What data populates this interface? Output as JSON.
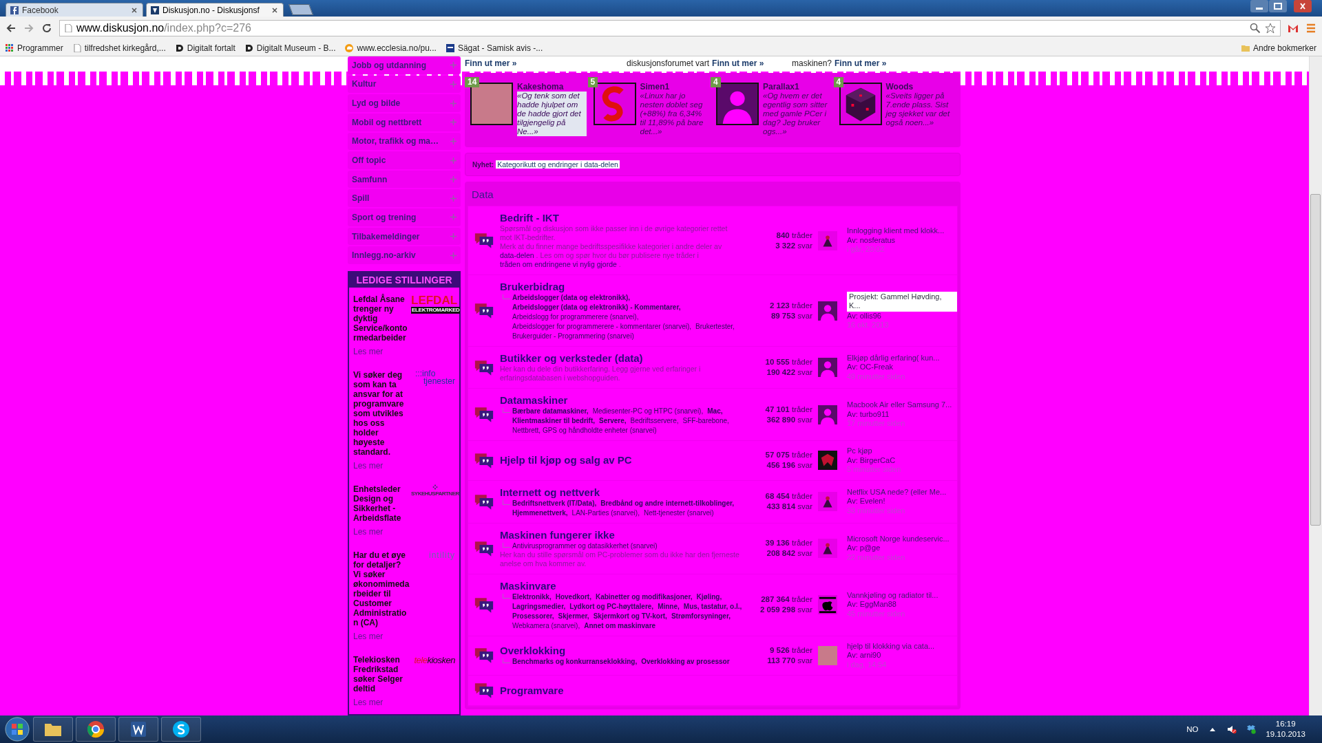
{
  "browser": {
    "tabs": [
      {
        "title": "Facebook",
        "selected": false
      },
      {
        "title": "Diskusjon.no - Diskusjonsf",
        "selected": true
      }
    ],
    "url_domain": "www.diskusjon.no",
    "url_path": "/index.php?c=276",
    "bookmarks": [
      "Programmer",
      "tilfredshet kirkegård,...",
      "Digitalt fortalt",
      "Digitalt Museum - B...",
      "www.ecclesia.no/pu...",
      "Sägat - Samisk avis -..."
    ],
    "other_bookmarks": "Andre bokmerker"
  },
  "promos": [
    {
      "link": "Finn ut mer »"
    },
    {
      "text": "diskusjonsforumet vart",
      "link": "Finn ut mer »"
    },
    {
      "text": "maskinen?",
      "link": "Finn ut mer »"
    }
  ],
  "sidebar": {
    "categories": [
      "Jobb og utdanning",
      "Kultur",
      "Lyd og bilde",
      "Mobil og nettbrett",
      "Motor, trafikk og ma…",
      "Off topic",
      "Samfunn",
      "Spill",
      "Sport og trening",
      "Tilbakemeldinger",
      "Innlegg.no-arkiv"
    ],
    "jobs": {
      "title": "LEDIGE STILLINGER",
      "ads": [
        {
          "text": "Lefdal Åsane trenger ny dyktig Service/kontormedarbeider",
          "logo": {
            "kind": "lefdal",
            "lines": [
              "LEFDAL",
              "ELEKTROMARKED"
            ]
          },
          "more": "Les mer"
        },
        {
          "text": "Vi søker deg som kan ta ansvar for at programvare som utvikles hos oss holder høyeste standard.",
          "logo": {
            "kind": "info",
            "lines": [
              ":::info",
              "tjenester"
            ]
          },
          "more": "Les mer"
        },
        {
          "text": "Enhetsleder Design og Sikkerhet - Arbeidsflate",
          "logo": {
            "kind": "sykehus",
            "lines": [
              "SYKEHUSPARTNER"
            ]
          },
          "more": "Les mer"
        },
        {
          "text": "Har du et øye for detaljer? Vi søker økonomimedarbeider til Customer Administration (CA)",
          "logo": {
            "kind": "intility",
            "lines": [
              "intility"
            ]
          },
          "more": "Les mer"
        },
        {
          "text": "Telekiosken Fredrikstad søker Selger deltid",
          "logo": {
            "kind": "telekiosken",
            "lines": [
              "tele",
              "kiosken"
            ]
          },
          "more": "Les mer"
        }
      ]
    }
  },
  "top_posters": [
    {
      "count": "14",
      "name": "Kakeshoma",
      "quote": "«Og tenk som det hadde hjulpet om de hadde gjort det tilgjengelig på Ne...»",
      "highlighted": true
    },
    {
      "count": "5",
      "name": "Simen1",
      "quote": "«Linux har jo nesten doblet seg (+88%) fra 6,34% til 11,89% på bare det...»",
      "highlighted": false
    },
    {
      "count": "4",
      "name": "Parallax1",
      "quote": "«Og hvem er det egentlig som sitter med gamle PCer i dag? Jeg bruker ogs...»",
      "highlighted": false
    },
    {
      "count": "4",
      "name": "Woods",
      "quote": "«Sveits ligger på 7.ende plass. Sist jeg sjekket var det også noen...»",
      "highlighted": false
    }
  ],
  "news": {
    "label": "Nyhet:",
    "link": "Kategorikutt og endringer i data-delen"
  },
  "section": {
    "title": "Data",
    "forums": [
      {
        "title": "Bedrift - IKT",
        "description": [
          [
            {
              "text": "Spørsmål og diskusjon som ikke passer inn i de øvrige kategorier rettet mot IKT-bedrifter.",
              "link": false
            }
          ],
          [
            {
              "text": "Merk at du finner mange bedriftsspesifikke kategorier i andre deler av",
              "link": false
            },
            {
              "text": "data-delen",
              "link": true
            },
            {
              "text": ". Les om og spør hvor du bør publisere nye tråder i",
              "link": false
            },
            {
              "text": "tråden om endringene vi nylig gjorde",
              "link": true
            },
            {
              "text": ".",
              "link": false
            }
          ]
        ],
        "threads": "840",
        "threads_label": "tråder",
        "replies": "3 322",
        "replies_label": "svar",
        "last": {
          "title": "Innlogging klient med klokk...",
          "author": "Av: nosferatus",
          "time": "i går, 20:02",
          "highlighted": false
        }
      },
      {
        "title": "Brukerbidrag",
        "subforums": [
          {
            "name": "Arbeidslogger (data og elektronikk),",
            "bold": true
          },
          {
            "name": "Arbeidslogger (data og elektronikk) - Kommentarer,",
            "bold": true
          },
          {
            "name": "Arbeidslogg for programmerere (snarvei),",
            "bold": false
          },
          {
            "name": "Arbeidslogger for programmerere - kommentarer (snarvei),",
            "bold": false
          },
          {
            "name": "Brukertester,",
            "bold": false
          },
          {
            "name": "Brukerguider - Programmering (snarvei)",
            "bold": false
          }
        ],
        "threads": "2 123",
        "threads_label": "tråder",
        "replies": "89 753",
        "replies_label": "svar",
        "last": {
          "title": "Prosjekt: Gammel Høvding, K...",
          "author": "Av: ollis96",
          "time": "16 okt. 2013",
          "highlighted": true
        }
      },
      {
        "title": "Butikker og verksteder (data)",
        "description": [
          [
            {
              "text": "Her kan du dele din butikkerfaring. Legg gjerne ved erfaringer i erfaringsdatabasen i webshopguiden.",
              "link": false
            }
          ]
        ],
        "threads": "10 555",
        "threads_label": "tråder",
        "replies": "190 422",
        "replies_label": "svar",
        "last": {
          "title": "Elkjøp dårlig erfaring( kun...",
          "author": "Av: OC-Freak",
          "time": "49 minutter siden",
          "highlighted": false
        }
      },
      {
        "title": "Datamaskiner",
        "subforums": [
          {
            "name": "Bærbare datamaskiner,",
            "bold": true
          },
          {
            "name": "Mediesenter-PC og HTPC (snarvei),",
            "bold": false
          },
          {
            "name": "Mac,",
            "bold": true
          },
          {
            "name": "Klientmaskiner til bedrift,",
            "bold": true
          },
          {
            "name": "Servere,",
            "bold": true
          },
          {
            "name": "Bedriftsservere,",
            "bold": false
          },
          {
            "name": "SFF-barebone,",
            "bold": false
          },
          {
            "name": "Nettbrett, GPS og håndholdte enheter (snarvei)",
            "bold": false
          }
        ],
        "threads": "47 101",
        "threads_label": "tråder",
        "replies": "362 890",
        "replies_label": "svar",
        "last": {
          "title": "Macbook Air eller Samsung 7...",
          "author": "Av: turbo911",
          "time": "17 minutter siden",
          "highlighted": false
        }
      },
      {
        "title": "Hjelp til kjøp og salg av PC",
        "threads": "57 075",
        "threads_label": "tråder",
        "replies": "456 196",
        "replies_label": "svar",
        "last": {
          "title": "Pc kjøp",
          "author": "Av: BirgerCaC",
          "time": "5 minutter siden",
          "highlighted": false
        }
      },
      {
        "title": "Internett og nettverk",
        "subforums": [
          {
            "name": "Bedriftsnettverk (IT/Data),",
            "bold": true
          },
          {
            "name": "Bredbånd og andre internett-tilkoblinger,",
            "bold": true
          },
          {
            "name": "Hjemmenettverk,",
            "bold": true
          },
          {
            "name": "LAN-Parties (snarvei),",
            "bold": false
          },
          {
            "name": "Nett-tjenester (snarvei)",
            "bold": false
          }
        ],
        "threads": "68 454",
        "threads_label": "tråder",
        "replies": "433 814",
        "replies_label": "svar",
        "last": {
          "title": "Netflix USA nede? (eller Me...",
          "author": "Av: Evelen!",
          "time": "33 minutter siden",
          "highlighted": false
        }
      },
      {
        "title": "Maskinen fungerer ikke",
        "subforums": [
          {
            "name": "Antivirusprogrammer og datasikkerhet (snarvei)",
            "bold": false
          }
        ],
        "description": [
          [
            {
              "text": "Her kan du stille spørsmål om PC-problemer som du ikke har den fjerneste anelse om hva kommer av.",
              "link": false
            }
          ]
        ],
        "threads": "39 136",
        "threads_label": "tråder",
        "replies": "208 842",
        "replies_label": "svar",
        "last": {
          "title": "Microsoft Norge kundeservic...",
          "author": "Av: p@ge",
          "time": "22 minutter siden",
          "highlighted": false
        }
      },
      {
        "title": "Maskinvare",
        "subforums": [
          {
            "name": "Elektronikk,",
            "bold": true
          },
          {
            "name": "Hovedkort,",
            "bold": true
          },
          {
            "name": "Kabinetter og modifikasjoner,",
            "bold": true
          },
          {
            "name": "Kjøling,",
            "bold": true
          },
          {
            "name": "Lagringsmedier,",
            "bold": true
          },
          {
            "name": "Lydkort og PC-høyttalere,",
            "bold": true
          },
          {
            "name": "Minne,",
            "bold": true
          },
          {
            "name": "Mus, tastatur, o.l.,",
            "bold": true
          },
          {
            "name": "Prosessorer,",
            "bold": true
          },
          {
            "name": "Skjermer,",
            "bold": true
          },
          {
            "name": "Skjermkort og TV-kort,",
            "bold": true
          },
          {
            "name": "Strømforsyninger,",
            "bold": true
          },
          {
            "name": "Webkamera (snarvei),",
            "bold": false
          },
          {
            "name": "Annet om maskinvare",
            "bold": true
          }
        ],
        "threads": "287 364",
        "threads_label": "tråder",
        "replies": "2 059 298",
        "replies_label": "svar",
        "last": {
          "title": "Vannkjøling og radiator til...",
          "author": "Av: EggMan88",
          "time": "45 minutter siden",
          "highlighted": false
        }
      },
      {
        "title": "Overklokking",
        "subforums": [
          {
            "name": "Benchmarks og konkurranseklokking,",
            "bold": true
          },
          {
            "name": "Overklokking av prosessor",
            "bold": true
          }
        ],
        "threads": "9 526",
        "threads_label": "tråder",
        "replies": "113 770",
        "replies_label": "svar",
        "last": {
          "title": "hjelp til klokking via cata...",
          "author": "Av: arni90",
          "time": "i dag, 14:54",
          "highlighted": false
        }
      },
      {
        "title": "Programvare"
      }
    ]
  },
  "taskbar": {
    "language": "NO",
    "time": "16:19",
    "date": "19.10.2013"
  }
}
